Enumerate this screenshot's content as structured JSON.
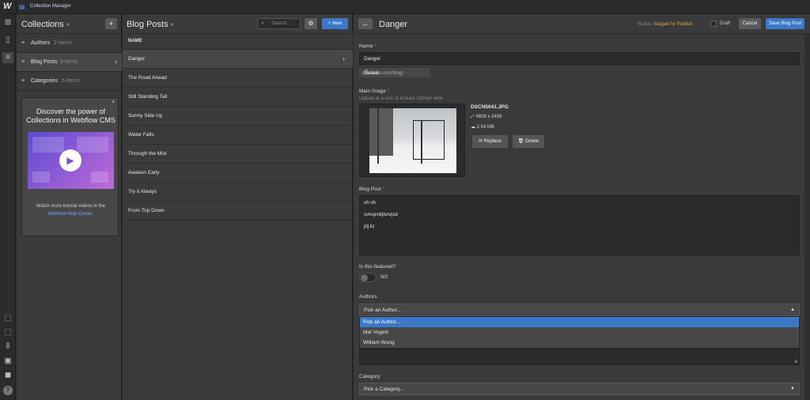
{
  "app": {
    "logo": "W",
    "title": "Collection Manager"
  },
  "rail": {
    "icons": [
      "add-icon",
      "page-icon",
      "database-icon",
      "select-icon",
      "select-dashed-icon",
      "barcode-icon",
      "image-icon",
      "video-icon",
      "help-icon"
    ],
    "help_glyph": "?"
  },
  "collections": {
    "title": "Collections",
    "close": "×",
    "add": "+",
    "items": [
      {
        "label": "Authors",
        "count": "2 items"
      },
      {
        "label": "Blog Posts",
        "count": "9 items"
      },
      {
        "label": "Categories",
        "count": "6 items"
      }
    ],
    "promo": {
      "close": "×",
      "title": "Discover the power of Collections in Webflow CMS",
      "sub": "Watch more tutorial videos in the",
      "link": "Webflow Help Center."
    }
  },
  "posts": {
    "title": "Blog Posts",
    "close": "×",
    "search_placeholder": "Search...",
    "new_label": "+ New",
    "column": "NAME",
    "rows": [
      "Danger",
      "The Road Ahead",
      "Still Standing Tall",
      "Sunny Side Up",
      "Water Falls",
      "Through the Mist",
      "Awaken Early",
      "Try it Always",
      "From Top Down"
    ]
  },
  "editor": {
    "title": "Danger",
    "status_label": "Status:",
    "status_value": "Staged for Publish",
    "draft_label": "Draft",
    "cancel_label": "Cancel",
    "save_label": "Save Blog Post",
    "name_label": "Name",
    "name_value": "Danger",
    "slug_prefix": "website.com/blog/",
    "slug_value": "cereal",
    "image_label": "Main Image",
    "image_hint": "Upload at a size of at least 1500px wide",
    "image_file": "DSCN5641.JPG",
    "image_dims": "4608 x 3456",
    "image_size": "2.94 MB",
    "replace_label": "Replace",
    "delete_label": "Delete",
    "post_label": "Blog Post",
    "post_lines": [
      "uh oh",
      "svnsjvnkjlsnvjsd",
      "jdj kz"
    ],
    "featured_label": "Is this featured?",
    "featured_value": "NO",
    "authors_label": "Authors",
    "authors_value": "Pick an Author...",
    "authors_options": [
      "Pick an Author...",
      "Mat Vogels",
      "William Wong"
    ],
    "category_label": "Category",
    "category_value": "Pick a Category..."
  },
  "colors": {
    "accent": "#3c78c8",
    "status": "#e8a13c",
    "required": "#e05a4a"
  }
}
